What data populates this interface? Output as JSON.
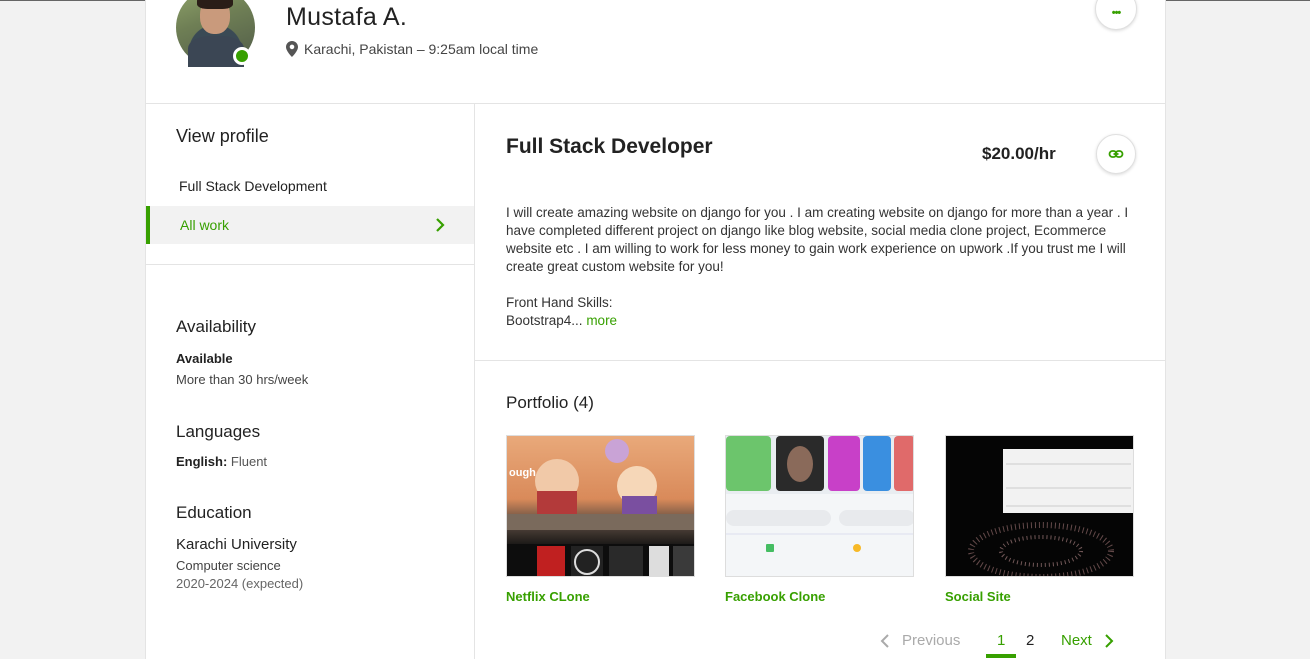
{
  "header": {
    "name": "Mustafa A.",
    "location": "Karachi, Pakistan – 9:25am local time",
    "more_label": "•••"
  },
  "sidebar": {
    "view_profile": "View profile",
    "nav": [
      {
        "label": "Full Stack Development"
      },
      {
        "label": "All work"
      }
    ],
    "availability": {
      "title": "Availability",
      "status": "Available",
      "hours": "More than 30 hrs/week"
    },
    "languages": {
      "title": "Languages",
      "language": "English:",
      "level": "Fluent"
    },
    "education": {
      "title": "Education",
      "school": "Karachi University",
      "field": "Computer science",
      "years": "2020-2024 (expected)"
    }
  },
  "main": {
    "title": "Full Stack Developer",
    "rate": "$20.00/hr",
    "description": "I will create amazing website on django for you . I am creating website on django for more than a year . I have completed different project on django like blog website, social media clone project, Ecommerce website etc . I am willing to work for less money to gain work experience on upwork .If you trust me I will create great custom website for you!",
    "skills_line1": "Front Hand Skills:",
    "skills_line2": "Bootstrap4...",
    "more_link": "more",
    "portfolio": {
      "title": "Portfolio (4)",
      "items": [
        {
          "caption": "Netflix CLone"
        },
        {
          "caption": "Facebook Clone"
        },
        {
          "caption": "Social Site"
        }
      ]
    },
    "pagination": {
      "previous": "Previous",
      "pages": [
        "1",
        "2"
      ],
      "next": "Next"
    }
  },
  "colors": {
    "accent": "#37a000",
    "background": "#f2f2f2"
  }
}
